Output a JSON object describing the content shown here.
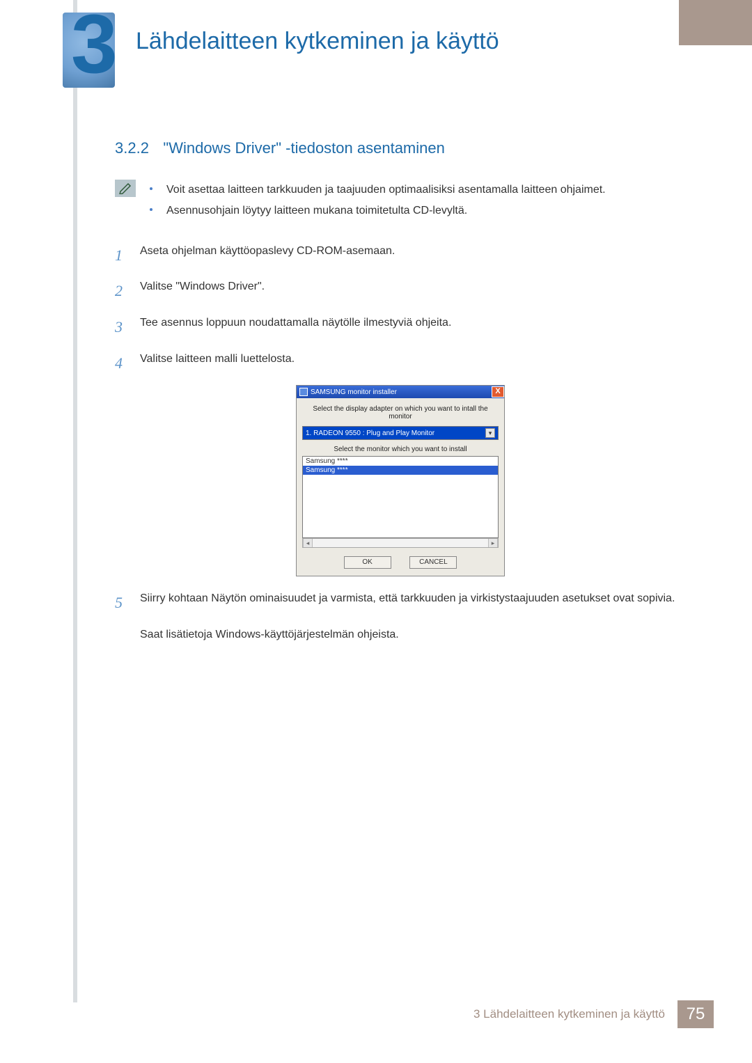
{
  "chapter": {
    "number": "3",
    "title": "Lähdelaitteen kytkeminen ja käyttö"
  },
  "section": {
    "number": "3.2.2",
    "title": "\"Windows Driver\" -tiedoston asentaminen"
  },
  "note": {
    "bullets": [
      "Voit asettaa laitteen tarkkuuden ja taajuuden optimaalisiksi asentamalla laitteen ohjaimet.",
      "Asennusohjain löytyy laitteen mukana toimitetulta CD-levyltä."
    ]
  },
  "steps": [
    {
      "num": "1",
      "text": "Aseta ohjelman käyttöopaslevy CD-ROM-asemaan."
    },
    {
      "num": "2",
      "text": "Valitse \"Windows Driver\"."
    },
    {
      "num": "3",
      "text": "Tee asennus loppuun noudattamalla näytölle ilmestyviä ohjeita."
    },
    {
      "num": "4",
      "text": "Valitse laitteen malli luettelosta."
    },
    {
      "num": "5",
      "text": "Siirry kohtaan Näytön ominaisuudet ja varmista, että tarkkuuden ja virkistystaajuuden asetukset ovat sopivia."
    },
    {
      "num": "",
      "text": "Saat lisätietoja Windows-käyttöjärjestelmän ohjeista."
    }
  ],
  "installer": {
    "title": "SAMSUNG monitor installer",
    "msg1": "Select the display adapter on which you want to intall the monitor",
    "select_value": "1. RADEON 9550 : Plug and Play Monitor",
    "msg2": "Select the monitor which you want to install",
    "list_item1": "Samsung ****",
    "list_item2": "Samsung ****",
    "ok": "OK",
    "cancel": "CANCEL",
    "close": "X"
  },
  "footer": {
    "text": "3 Lähdelaitteen kytkeminen ja käyttö",
    "page": "75"
  }
}
